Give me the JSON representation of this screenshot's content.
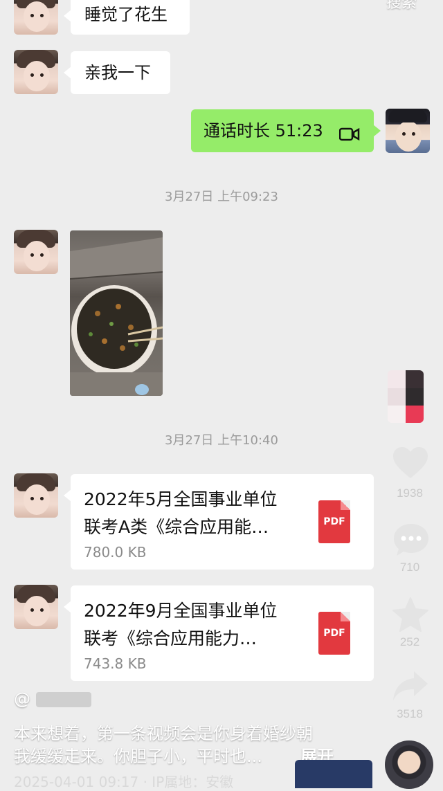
{
  "messages": {
    "msg1": "睡觉了花生",
    "msg2": "亲我一下",
    "call": "通话时长 51:23",
    "ts1": "3月27日 上午09:23",
    "ts2": "3月27日 上午10:40",
    "file1": {
      "line1": "2022年5月全国事业单位",
      "line2": "联考A类《综合应用能…",
      "size": "780.0 KB",
      "badge": "PDF"
    },
    "file2": {
      "line1": "2022年9月全国事业单位",
      "line2": "联考《综合应用能力…",
      "size": "743.8 KB",
      "badge": "PDF"
    }
  },
  "top_right_label": "搜索",
  "sidebar": {
    "like_count": "1938",
    "comment_count": "710",
    "favorite_count": "252",
    "share_count": "3518"
  },
  "caption": {
    "author": "@",
    "line1": "本来想着，第一条视频会是你身着婚纱朝",
    "line2": "我缓缓走来。你胆子小，平时也...",
    "expand": "展开",
    "meta": "2025-04-01 09:17 · IP属地：安徽"
  },
  "colors": {
    "background": "#ededed",
    "bubble_right": "#95ec69",
    "pdf_red": "#e2393f"
  }
}
